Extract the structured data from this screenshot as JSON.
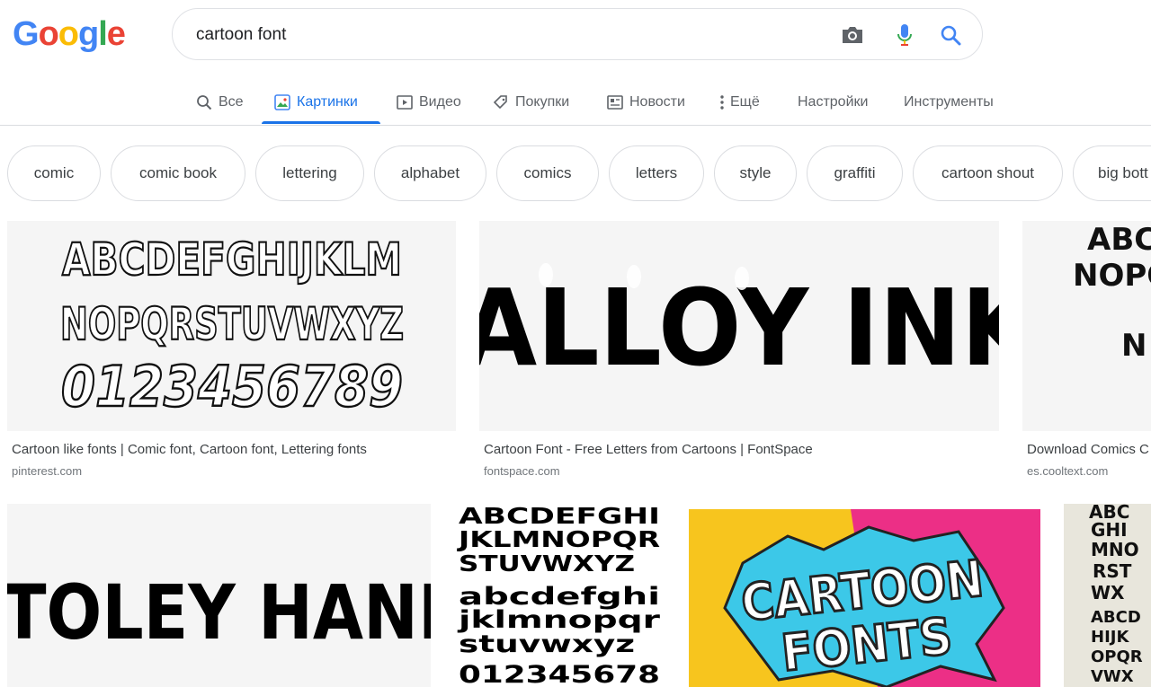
{
  "logo": {
    "letters": [
      "G",
      "o",
      "o",
      "g",
      "l",
      "e"
    ],
    "colors": [
      "#4285f4",
      "#ea4335",
      "#fbbc05",
      "#4285f4",
      "#34a853",
      "#ea4335"
    ]
  },
  "search": {
    "query": "cartoon font",
    "icons": [
      "camera-icon",
      "microphone-icon",
      "search-icon"
    ]
  },
  "tabs": [
    {
      "label": "Все",
      "icon": "search-icon"
    },
    {
      "label": "Картинки",
      "icon": "image-icon",
      "active": true
    },
    {
      "label": "Видео",
      "icon": "video-icon"
    },
    {
      "label": "Покупки",
      "icon": "tag-icon"
    },
    {
      "label": "Новости",
      "icon": "news-icon"
    },
    {
      "label": "Ещё",
      "icon": "more-vertical-icon"
    },
    {
      "label": "Настройки"
    },
    {
      "label": "Инструменты"
    }
  ],
  "chips": [
    "comic",
    "comic book",
    "lettering",
    "alphabet",
    "comics",
    "letters",
    "style",
    "graffiti",
    "cartoon shout",
    "big bott"
  ],
  "results": [
    {
      "title": "Cartoon like fonts | Comic font, Cartoon font, Lettering fonts",
      "source": "pinterest.com",
      "image_text": [
        "ABCDEFGHIJKLM",
        "NOPQRSTUVWXYZ",
        "0123456789"
      ]
    },
    {
      "title": "Cartoon Font - Free Letters from Cartoons | FontSpace",
      "source": "fontspace.com",
      "image_text": [
        "ALLOY INK"
      ]
    },
    {
      "title": "Download Comics C",
      "source": "es.cooltext.com",
      "image_text": [
        "ABC",
        "NOPQ",
        "N"
      ]
    },
    {
      "title": "",
      "source": "",
      "image_text": [
        "TOLEY HANI"
      ]
    },
    {
      "title": "",
      "source": "",
      "image_text": [
        "ABCDEFGHI",
        "JKLMNOPQR",
        "STUVWXYZ",
        "abcdefghi",
        "jklmnopqr",
        "stuvwxyz",
        "012345678"
      ]
    },
    {
      "title": "",
      "source": "",
      "image_text": [
        "CARTOON",
        "FONTS"
      ]
    },
    {
      "title": "",
      "source": "",
      "image_text": [
        "ABC",
        "GHI",
        "MNO",
        "RST",
        "WX",
        "ABCD",
        "HIJK",
        "OPQR",
        "VWX"
      ]
    }
  ]
}
